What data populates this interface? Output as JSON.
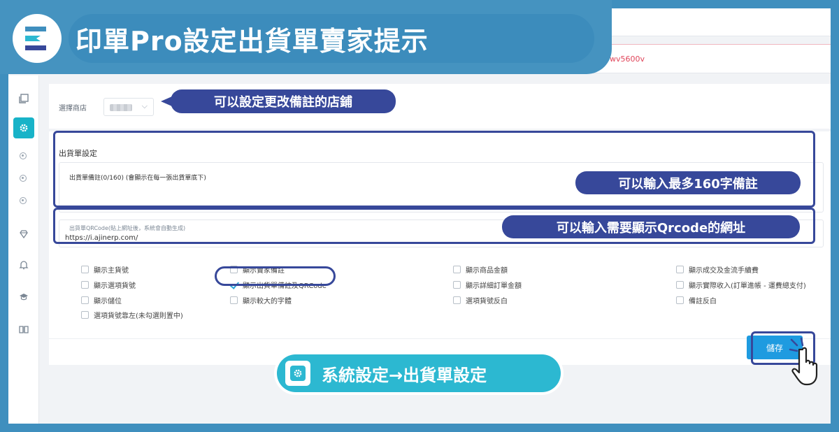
{
  "banner": {
    "title": "印單Pro設定出貨單賣家提示"
  },
  "notice": {
    "text": "wv5600v"
  },
  "store": {
    "label": "選擇商店",
    "callout": "可以設定更改備註的店鋪"
  },
  "shipping": {
    "section_title": "出貨單設定",
    "note_label": "出貨單備註(0/160) (會顯示在每一張出貨單底下)",
    "note_callout": "可以輸入最多160字備註",
    "qr_label": "出貨單QRCode(貼上網址後，系統會自動生成)",
    "qr_value": "https://i.ajinerp.com/",
    "qr_callout": "可以輸入需要顯示Qrcode的網址"
  },
  "options": [
    {
      "label": "顯示主貨號",
      "checked": false
    },
    {
      "label": "顯示賣家備註",
      "checked": false
    },
    {
      "label": "顯示商品金額",
      "checked": false
    },
    {
      "label": "顯示成交及金流手續費",
      "checked": false
    },
    {
      "label": "顯示選項貨號",
      "checked": false
    },
    {
      "label": "顯示出貨單備註及QRCode",
      "checked": true
    },
    {
      "label": "顯示詳細訂單金額",
      "checked": false
    },
    {
      "label": "顯示實際收入(訂單進帳 - 運費總支付)",
      "checked": false
    },
    {
      "label": "顯示儲位",
      "checked": false
    },
    {
      "label": "顯示較大的字體",
      "checked": false
    },
    {
      "label": "選項貨號反白",
      "checked": false
    },
    {
      "label": "備註反白",
      "checked": false
    },
    {
      "label": "選項貨號靠左(未勾選則置中)",
      "checked": false
    }
  ],
  "actions": {
    "save": "儲存"
  },
  "navigation": {
    "path": "系統設定→出貨單設定"
  },
  "colors": {
    "background": "#3f8fbe",
    "callout": "#37489a",
    "accent": "#2cb8d1",
    "save": "#1e9be0"
  }
}
